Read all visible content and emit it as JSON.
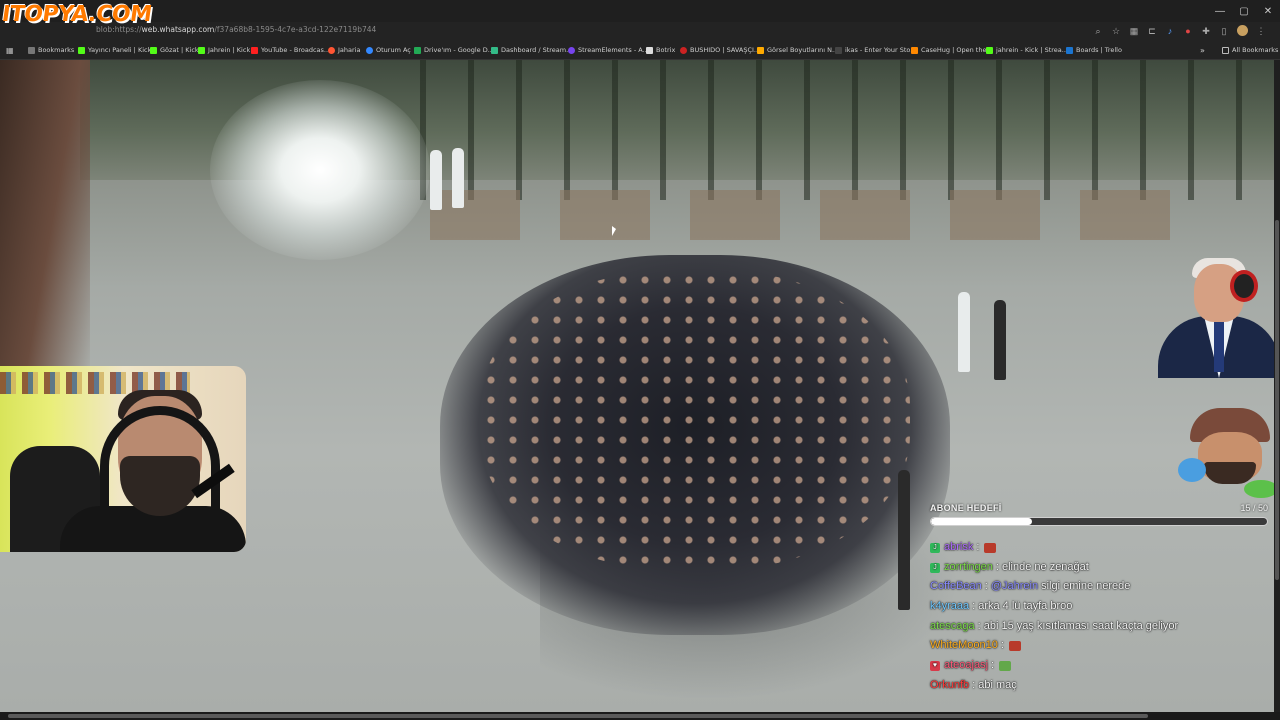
{
  "browser": {
    "url_prefix": "blob:https://",
    "url_host": "web.whatsapp.com",
    "url_path": "/f37a68b8-1595-4c7e-a3cd-122e7119b744",
    "window_controls": [
      "—",
      "▢",
      "✕"
    ],
    "all_bookmarks_label": "All Bookmarks"
  },
  "bookmarks": [
    {
      "label": "Bookmarks",
      "color": "#bbbbbb"
    },
    {
      "label": "Yayıncı Paneli | Kick",
      "color": "#53fc18"
    },
    {
      "label": "Gözat | Kick",
      "color": "#53fc18"
    },
    {
      "label": "Jahrein | Kick",
      "color": "#53fc18"
    },
    {
      "label": "YouTube - Broadcas...",
      "color": "#ff2020"
    },
    {
      "label": "Jaharia",
      "color": "#ff5533"
    },
    {
      "label": "Oturum Aç",
      "color": "#3388ff"
    },
    {
      "label": "Drive'ım - Google D...",
      "color": "#22aa55"
    },
    {
      "label": "Dashboard / Stream...",
      "color": "#33bb88"
    },
    {
      "label": "StreamElements - A...",
      "color": "#7744ee"
    },
    {
      "label": "Botrix",
      "color": "#dddddd"
    },
    {
      "label": "BUSHIDO | SAVAŞÇI...",
      "color": "#cc2222"
    },
    {
      "label": "Görsel Boyutlarını N...",
      "color": "#ffaa00"
    },
    {
      "label": "ikas - Enter Your Sto...",
      "color": "#444444"
    },
    {
      "label": "CaseHug | Open the...",
      "color": "#ff8800"
    },
    {
      "label": "jahrein - Kick | Strea...",
      "color": "#53fc18"
    },
    {
      "label": "Boards | Trello",
      "color": "#1b75d0"
    }
  ],
  "watermark": "ITOPYA.COM",
  "stream_overlay": {
    "sub_goal": {
      "title": "ABONE HEDEFİ",
      "count": "15 / 50",
      "progress": 0.3
    },
    "chat": [
      {
        "user": "abrisk",
        "user_color": "#b06cff",
        "badge_color": "#2fb85a",
        "badge": "J",
        "text": "",
        "emoji": "red"
      },
      {
        "user": "zorrtingen",
        "user_color": "#7dde4a",
        "badge_color": "#2fb85a",
        "badge": "J",
        "text": "elinde ne zenağat"
      },
      {
        "user": "CoffeBean",
        "user_color": "#8a8cff",
        "badge_color": "",
        "badge": "",
        "mention": "@Jahrein",
        "text": "silgi emine nerede"
      },
      {
        "user": "k4yraaa",
        "user_color": "#70c8ff",
        "badge_color": "",
        "badge": "",
        "text": "arka 4 lü tayfa broo"
      },
      {
        "user": "atescaga",
        "user_color": "#7dde4a",
        "badge_color": "",
        "badge": "",
        "text": "abi 15 yaş kısıtlaması saat kaçta geliyor"
      },
      {
        "user": "WhiteMoon10",
        "user_color": "#ffb020",
        "badge_color": "",
        "badge": "",
        "text": "",
        "emoji": "red"
      },
      {
        "user": "ateoajasj",
        "user_color": "#ff5a7a",
        "badge_color": "#d83a4a",
        "badge": "♥",
        "text": "",
        "emoji": "green"
      },
      {
        "user": "Orkunfb",
        "user_color": "#ff3a3a",
        "badge_color": "",
        "badge": "",
        "text": "abi maç"
      }
    ]
  }
}
